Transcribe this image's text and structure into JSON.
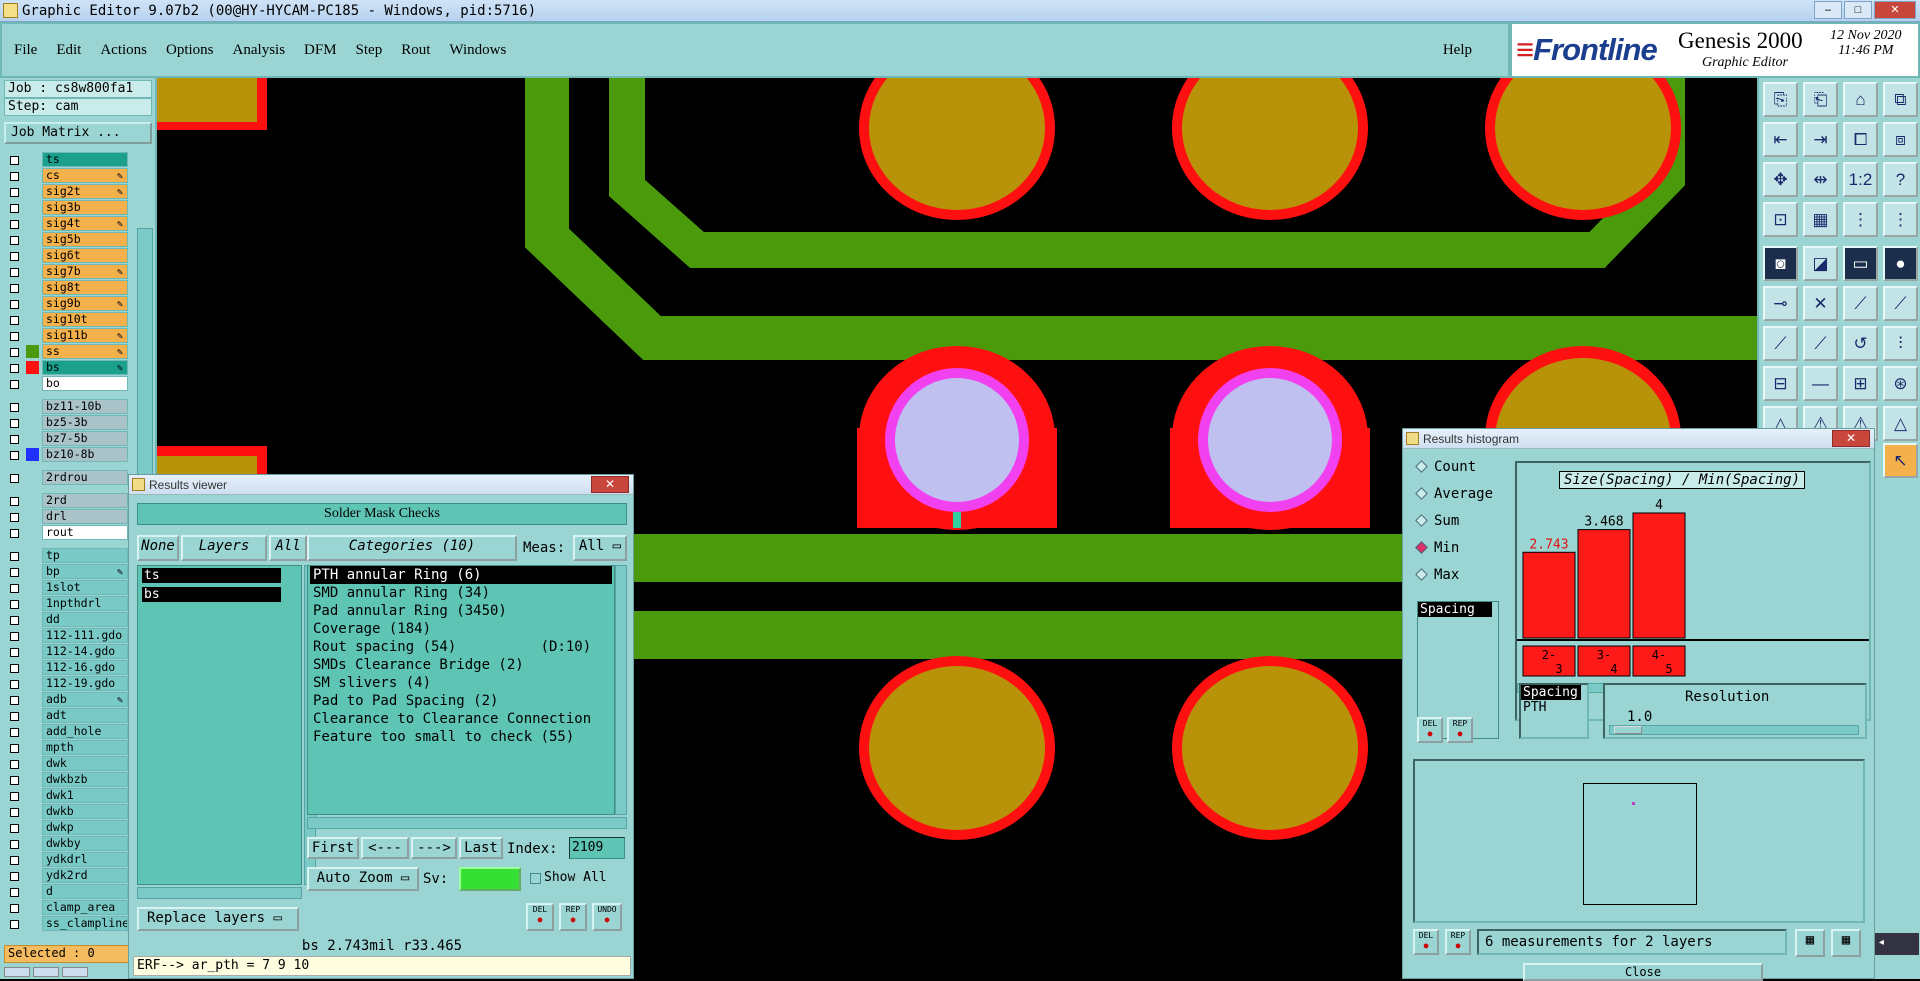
{
  "window": {
    "title": "Graphic Editor 9.07b2 (00@HY-HYCAM-PC185 - Windows, pid:5716)"
  },
  "menu": {
    "items": [
      "File",
      "Edit",
      "Actions",
      "Options",
      "Analysis",
      "DFM",
      "Step",
      "Rout",
      "Windows"
    ],
    "help": "Help"
  },
  "brand": {
    "logo": "Frontline",
    "product": "Genesis 2000",
    "subtitle": "Graphic Editor",
    "date": "12 Nov 2020",
    "time": "11:46 PM"
  },
  "job": {
    "job_label": "Job : cs8w800fa1",
    "step_label": "Step: cam",
    "job_matrix_button": "Job Matrix ..."
  },
  "layers": [
    {
      "name": "ts",
      "color": "#1aa08c",
      "edit": false
    },
    {
      "name": "cs",
      "color": "#f4b04a",
      "edit": true
    },
    {
      "name": "sig2t",
      "color": "#f4b04a",
      "edit": true
    },
    {
      "name": "sig3b",
      "color": "#f4b04a",
      "edit": false
    },
    {
      "name": "sig4t",
      "color": "#f4b04a",
      "edit": true
    },
    {
      "name": "sig5b",
      "color": "#f4b04a",
      "edit": false
    },
    {
      "name": "sig6t",
      "color": "#f4b04a",
      "edit": false
    },
    {
      "name": "sig7b",
      "color": "#f4b04a",
      "edit": true
    },
    {
      "name": "sig8t",
      "color": "#f4b04a",
      "edit": false
    },
    {
      "name": "sig9b",
      "color": "#f4b04a",
      "edit": true
    },
    {
      "name": "sig10t",
      "color": "#f4b04a",
      "edit": false
    },
    {
      "name": "sig11b",
      "color": "#f4b04a",
      "edit": true
    },
    {
      "name": "ss",
      "color": "#f4b04a",
      "edit": true
    },
    {
      "name": "bs",
      "color": "#1aa08c",
      "edit": true
    },
    {
      "name": "bo",
      "color": "#ffffff",
      "edit": false
    },
    {
      "gap": true
    },
    {
      "name": "bz11-10b",
      "color": "#a9c3c8",
      "edit": false
    },
    {
      "name": "bz5-3b",
      "color": "#a9c3c8",
      "edit": false
    },
    {
      "name": "bz7-5b",
      "color": "#a9c3c8",
      "edit": false
    },
    {
      "name": "bz10-8b",
      "color": "#a9c3c8",
      "edit": false
    },
    {
      "gap": true
    },
    {
      "name": "2rdrou",
      "color": "#a9c3c8",
      "edit": false
    },
    {
      "gap": true
    },
    {
      "name": "2rd",
      "color": "#a9c3c8",
      "edit": false
    },
    {
      "name": "drl",
      "color": "#a9c3c8",
      "edit": false
    },
    {
      "name": "rout",
      "color": "#ffffff",
      "edit": false
    },
    {
      "gap": true
    },
    {
      "name": "tp",
      "color": "#79c9c6",
      "edit": false
    },
    {
      "name": "bp",
      "color": "#79c9c6",
      "edit": true
    },
    {
      "name": "1slot",
      "color": "#79c9c6",
      "edit": false
    },
    {
      "name": "1npthdrl",
      "color": "#79c9c6",
      "edit": false
    },
    {
      "name": "dd",
      "color": "#79c9c6",
      "edit": false
    },
    {
      "name": "112-111.gdo",
      "color": "#79c9c6",
      "edit": false
    },
    {
      "name": "112-14.gdo",
      "color": "#79c9c6",
      "edit": false
    },
    {
      "name": "112-16.gdo",
      "color": "#79c9c6",
      "edit": false
    },
    {
      "name": "112-19.gdo",
      "color": "#79c9c6",
      "edit": false
    },
    {
      "name": "adb",
      "color": "#79c9c6",
      "edit": true
    },
    {
      "name": "adt",
      "color": "#79c9c6",
      "edit": false
    },
    {
      "name": "add_hole",
      "color": "#79c9c6",
      "edit": false
    },
    {
      "name": "mpth",
      "color": "#79c9c6",
      "edit": false
    },
    {
      "name": "dwk",
      "color": "#79c9c6",
      "edit": false
    },
    {
      "name": "dwkbzb",
      "color": "#79c9c6",
      "edit": false
    },
    {
      "name": "dwk1",
      "color": "#79c9c6",
      "edit": false
    },
    {
      "name": "dwkb",
      "color": "#79c9c6",
      "edit": false
    },
    {
      "name": "dwkp",
      "color": "#79c9c6",
      "edit": false
    },
    {
      "name": "dwkby",
      "color": "#79c9c6",
      "edit": false
    },
    {
      "name": "ydkdrl",
      "color": "#79c9c6",
      "edit": false
    },
    {
      "name": "ydk2rd",
      "color": "#79c9c6",
      "edit": false
    },
    {
      "name": "d",
      "color": "#79c9c6",
      "edit": false
    },
    {
      "name": "clamp_area",
      "color": "#79c9c6",
      "edit": false
    },
    {
      "name": "ss_clampline",
      "color": "#79c9c6",
      "edit": false
    }
  ],
  "selected": "Selected : 0",
  "results_viewer": {
    "title": "Results viewer",
    "heading": "Solder Mask Checks",
    "none_btn": "None",
    "layers_btn": "Layers",
    "all_btn": "All",
    "layer_items": [
      "ts",
      "bs"
    ],
    "categories_label": "Categories (10)",
    "meas_label": "Meas:",
    "meas_value": "All",
    "categories": [
      {
        "name": "PTH annular Ring (6)",
        "selected": true
      },
      {
        "name": "SMD annular Ring (34)",
        "selected": false
      },
      {
        "name": "Pad annular Ring (3450)",
        "selected": false
      },
      {
        "name": "Coverage (184)",
        "selected": false
      },
      {
        "name": "Rout spacing (54)          (D:10)",
        "selected": false
      },
      {
        "name": "SMDs Clearance Bridge (2)",
        "selected": false
      },
      {
        "name": "SM slivers (4)",
        "selected": false
      },
      {
        "name": "Pad to Pad Spacing (2)",
        "selected": false
      },
      {
        "name": "Clearance to Clearance Connection",
        "selected": false
      },
      {
        "name": "Feature too small to check (55)",
        "selected": false
      }
    ],
    "first_btn": "First",
    "prev_btn": "<---",
    "next_btn": "--->",
    "last_btn": "Last",
    "index_label": "Index:",
    "index_value": "2109",
    "auto_zoom": "Auto Zoom",
    "sv_label": "Sv:",
    "show_all": "Show All",
    "replace_layers": "Replace layers",
    "del_btn": "DEL",
    "rep_btn": "REP",
    "undo_btn": "UNDO",
    "status": "bs 2.743mil  r33.465",
    "erf": "ERF--> ar_pth = 7 9 10"
  },
  "histogram": {
    "title": "Results histogram",
    "options": [
      {
        "name": "Count",
        "selected": false
      },
      {
        "name": "Average",
        "selected": false
      },
      {
        "name": "Sum",
        "selected": false
      },
      {
        "name": "Min",
        "selected": true
      },
      {
        "name": "Max",
        "selected": false
      }
    ],
    "chart_title": "Size(Spacing) / Min(Spacing)",
    "list_item": "Spacing",
    "del_btn": "DEL",
    "rep_btn": "REP",
    "bars": [
      {
        "label_top": "2-",
        "label_bottom": "3",
        "value": 2.743,
        "value_label": "2.743",
        "highlight": true
      },
      {
        "label_top": "3-",
        "label_bottom": "4",
        "value": 3.468,
        "value_label": "3.468",
        "highlight": false
      },
      {
        "label_top": "4-",
        "label_bottom": "5",
        "value": 4,
        "value_label": "4",
        "highlight": false
      }
    ],
    "attr_name": "Spacing",
    "attr_value": "PTH",
    "resolution_label": "Resolution",
    "resolution_value": "1.0",
    "status": "6 measurements for 2 layers",
    "close_btn": "Close"
  },
  "colors": {
    "copper": "#b8930a",
    "mask": "#ff1010",
    "trace": "#4a9a0c",
    "drill": "#c0c0f0",
    "ring": "#f040f0",
    "panel": "#9ad5d3",
    "list": "#5ec5b5"
  },
  "lang": "EN"
}
